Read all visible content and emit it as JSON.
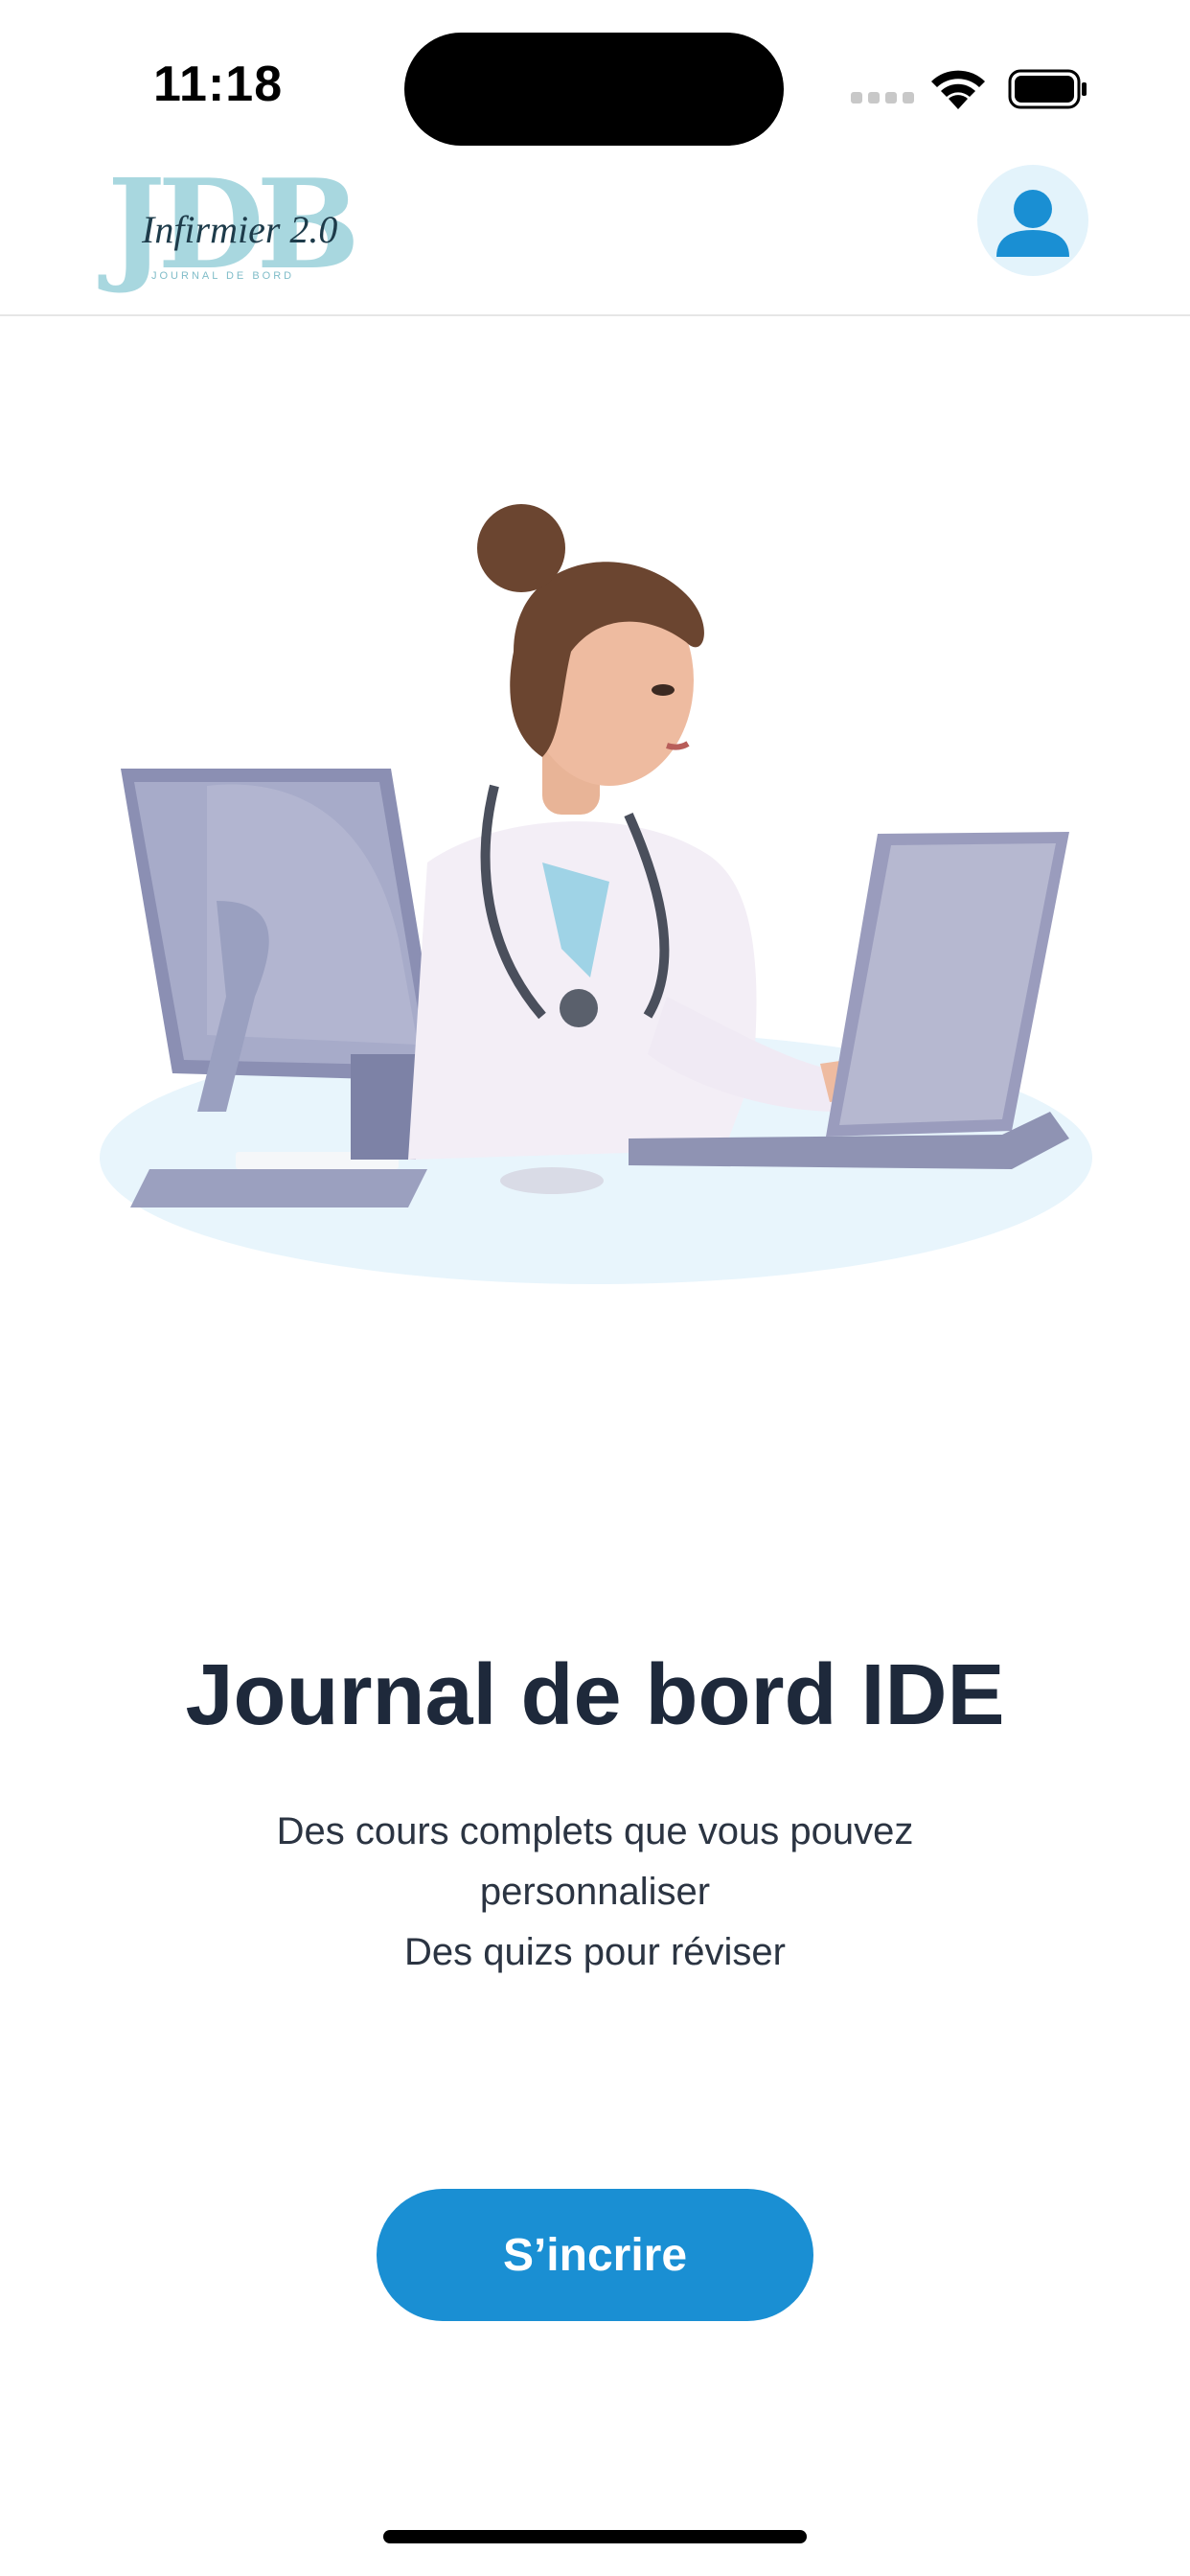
{
  "status_bar": {
    "time": "11:18",
    "icons": [
      "cellular-signal-icon",
      "wifi-icon",
      "battery-icon"
    ]
  },
  "header": {
    "logo": {
      "letters": "JDB",
      "script": "Infirmier 2.0",
      "tagline": "JOURNAL DE BORD"
    },
    "profile_icon": "user-icon"
  },
  "hero": {
    "image": "nurse-at-computer-illustration"
  },
  "main": {
    "title": "Journal de bord IDE",
    "subtitle_lines": [
      "Des cours complets que vous pouvez",
      "personnaliser",
      "Des quizs pour réviser"
    ],
    "cta_label": "S’incrire"
  },
  "colors": {
    "accent": "#1a8fd3",
    "title": "#1e293b",
    "text": "#2b3442",
    "profile_bg": "#e3f3fb",
    "hero_ellipse": "#e8f5fc"
  }
}
